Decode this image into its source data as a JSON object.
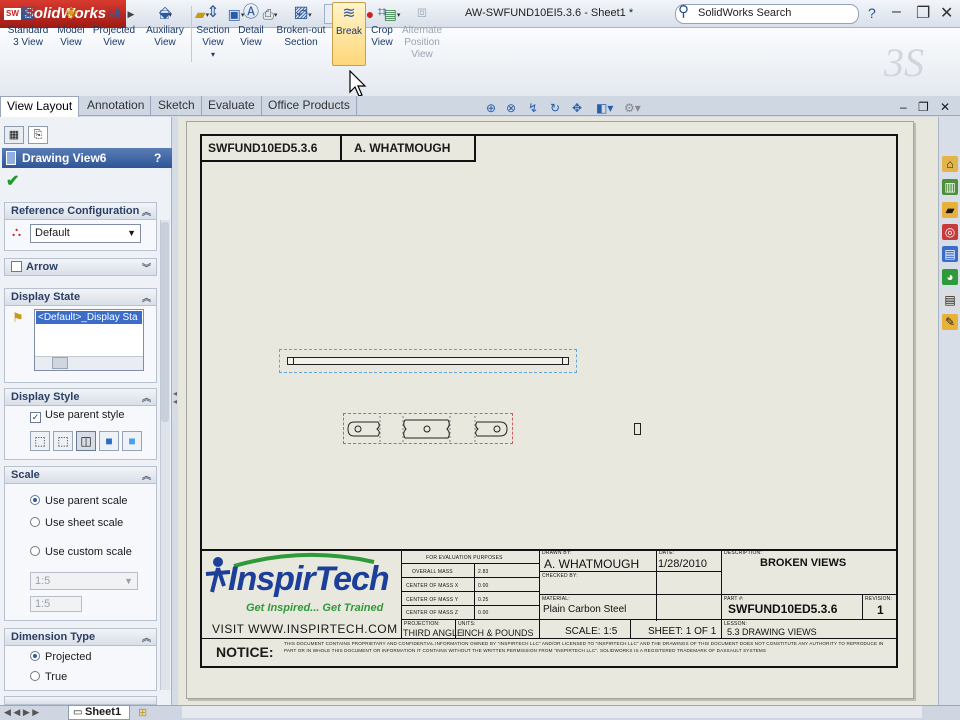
{
  "app": {
    "name": "SolidWorks",
    "logo_badge": "SW",
    "document_title": "AW-SWFUND10EI5.3.6 - Sheet1 *"
  },
  "search": {
    "placeholder": "SolidWorks Search"
  },
  "toolbar": {
    "tools": [
      {
        "label": "Standard 3 View",
        "icon": "standard-3-view-icon",
        "enabled": true
      },
      {
        "label": "Model View",
        "icon": "model-view-icon",
        "enabled": true
      },
      {
        "label": "Projected View",
        "icon": "projected-view-icon",
        "enabled": true
      },
      {
        "label": "Auxiliary View",
        "icon": "auxiliary-view-icon",
        "enabled": true
      },
      {
        "label": "Section View",
        "icon": "section-view-icon",
        "enabled": true
      },
      {
        "label": "Detail View",
        "icon": "detail-view-icon",
        "enabled": true
      },
      {
        "label": "Broken-out Section",
        "icon": "broken-out-section-icon",
        "enabled": true
      },
      {
        "label": "Break",
        "icon": "break-icon",
        "enabled": true
      },
      {
        "label": "Crop View",
        "icon": "crop-view-icon",
        "enabled": true
      },
      {
        "label": "Alternate Position View",
        "icon": "alternate-position-view-icon",
        "enabled": false
      }
    ]
  },
  "tabs": [
    "View Layout",
    "Annotation",
    "Sketch",
    "Evaluate",
    "Office Products"
  ],
  "property_manager": {
    "title": "Drawing View6",
    "help": "?",
    "reference_configuration": {
      "header": "Reference Configuration",
      "value": "Default"
    },
    "arrow": {
      "header": "Arrow"
    },
    "display_state": {
      "header": "Display State",
      "item": "<Default>_Display Sta"
    },
    "display_style": {
      "header": "Display Style",
      "use_parent": "Use parent style"
    },
    "scale": {
      "header": "Scale",
      "options": [
        "Use parent scale",
        "Use sheet scale",
        "Use custom scale"
      ],
      "combo": "1:5",
      "field": "1:5"
    },
    "dimension_type": {
      "header": "Dimension Type",
      "options": [
        "Projected",
        "True"
      ]
    }
  },
  "sheet": {
    "top_box_left": "SWFUND10ED5.3.6",
    "top_box_right": "A. WHATMOUGH"
  },
  "title_block": {
    "eval_header": "FOR EVALUATION PURPOSES",
    "mass_rows": [
      {
        "label": "OVERALL MASS",
        "value": "2.83"
      },
      {
        "label": "CENTER OF MASS X",
        "value": "0.00"
      },
      {
        "label": "CENTER OF MASS Y",
        "value": "0.25"
      },
      {
        "label": "CENTER OF MASS Z",
        "value": "0.00"
      }
    ],
    "projection_label": "PROJECTION:",
    "projection": "THIRD ANGLE",
    "units_label": "UNITS:",
    "units": "INCH & POUNDS",
    "drawn_by_label": "DRAWN BY:",
    "drawn_by": "A. WHATMOUGH",
    "checked_by_label": "CHECKED BY:",
    "date_label": "DATE:",
    "date": "1/28/2010",
    "material_label": "MATERIAL:",
    "material": "Plain Carbon Steel",
    "description_label": "DESCRIPTION:",
    "description": "BROKEN VIEWS",
    "part_label": "PART #:",
    "part": "SWFUND10ED5.3.6",
    "revision_label": "REVISION:",
    "revision": "1",
    "scale": "SCALE: 1:5",
    "sheet": "SHEET: 1 OF 1",
    "lesson_label": "LESSON:",
    "lesson": "5.3 DRAWING VIEWS",
    "company_name": "InspirTech",
    "tagline": "Get Inspired... Get Trained",
    "visit": "VISIT WWW.INSPIRTECH.COM",
    "notice": "NOTICE:",
    "notice_text": "THIS DOCUMENT CONTAINS PROPRIETARY AND CONFIDENTIAL INFORMATION OWNED BY \"INSPIRTECH LLC\" AND/OR LICENSED TO \"INSPIRTECH LLC\" AND THE DRAWINGS OF THIS DOCUMENT DOES NOT CONSTITUTE ANY AUTHORITY TO REPRODUCE IN PART OR IN WHOLE THIS DOCUMENT OR INFORMATION IT CONTAINS WITHOUT THE WRITTEN PERMISSION FROM \"INSPIRTECH LLC\". SOLIDWORKS IS A REGISTERED TRADEMARK OF DASSAULT SYSTEMS"
  },
  "bottom": {
    "sheet_tab": "Sheet1"
  },
  "colors": {
    "brand_red": "#c8261c",
    "header_blue": "#2f5595",
    "inspirtech_green": "#2e9a3a",
    "inspirtech_blue": "#1c3f9a"
  }
}
